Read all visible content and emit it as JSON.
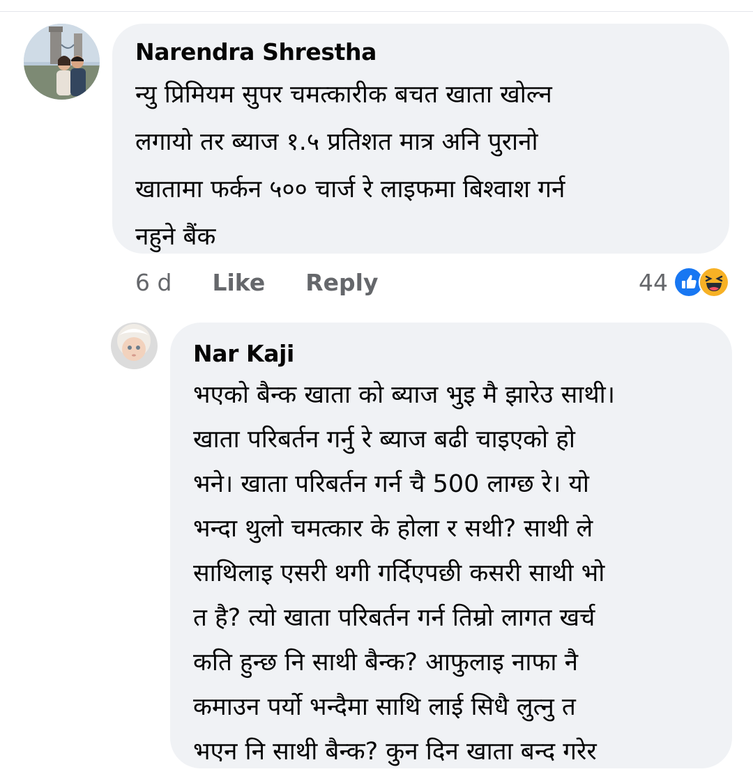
{
  "comments": [
    {
      "author": "Narendra Shrestha",
      "lines": [
        "न्यु प्रिमियम सुपर चमत्कारीक बचत खाता खोल्न",
        "लगायो तर ब्याज १.५ प्रतिशत मात्र अनि पुरानो",
        "खातामा फर्कन ५०० चार्ज रे लाइफमा बिश्वाश गर्न",
        "नहुने बैंक"
      ],
      "time": "6 d",
      "like_label": "Like",
      "reply_label": "Reply",
      "reaction_count": "44",
      "reaction_icons": [
        "like-icon",
        "haha-icon"
      ]
    },
    {
      "author": "Nar Kaji",
      "lines": [
        "भएको बैन्क खाता को ब्याज भुइ मै झारेउ साथी।",
        "खाता परिबर्तन गर्नु रे ब्याज बढी चाइएको हो",
        "भने। खाता परिबर्तन गर्न चै 500 लाग्छ रे। यो",
        "भन्दा थुलो चमत्कार के होला र सथी? साथी ले",
        "साथिलाइ एसरी थगी गर्दिएपछी कसरी साथी भो",
        "त है? त्यो खाता परिबर्तन गर्न तिम्रो लागत खर्च",
        "कति हुन्छ नि साथी बैन्क? आफुलाइ नाफा नै",
        "कमाउन पर्यो भन्दैमा साथि लाई सिधै लुत्नु त",
        "भएन नि साथी बैन्क? कुन दिन खाता बन्द गरेर"
      ]
    }
  ],
  "colors": {
    "bubble": "#f0f2f5",
    "meta_text": "#65676b",
    "like_blue": "#1877f2",
    "haha_yellow": "#f7b125"
  }
}
